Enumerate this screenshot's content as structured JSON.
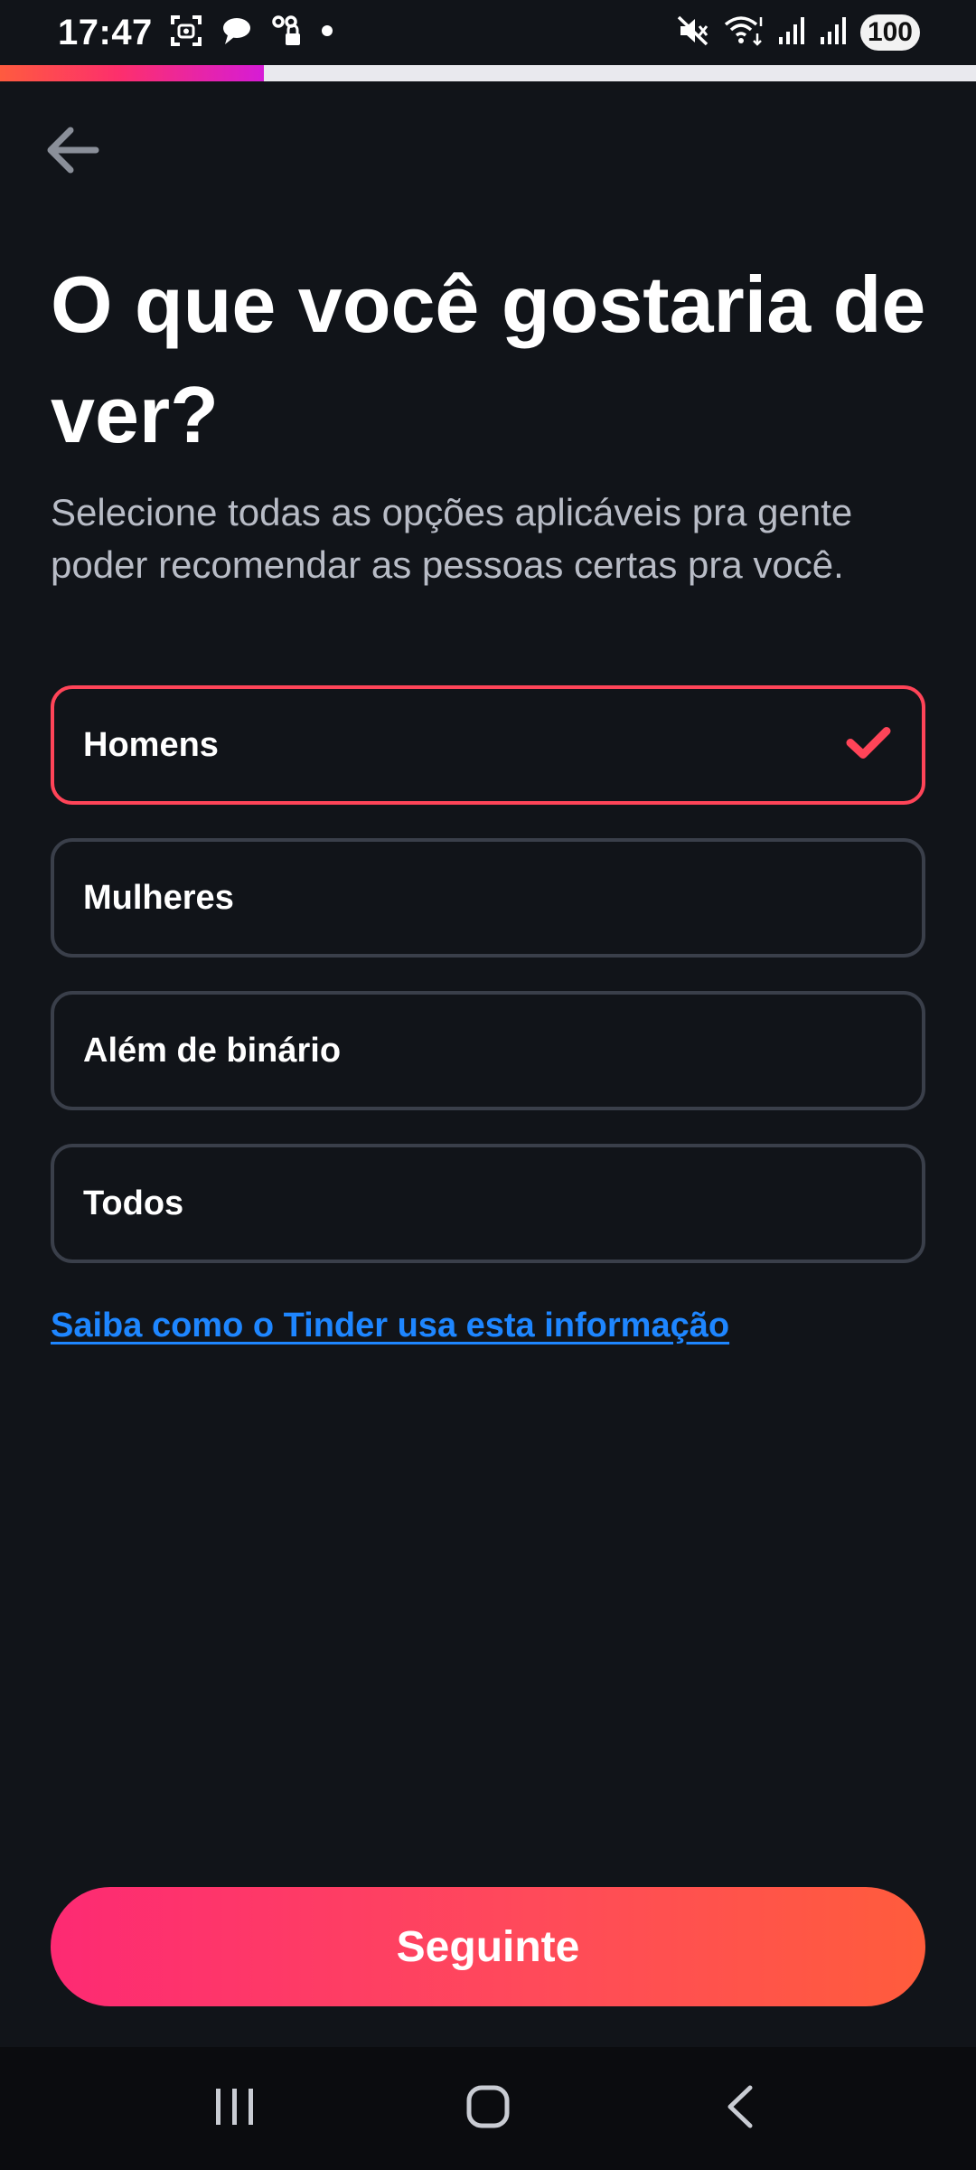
{
  "status_bar": {
    "time": "17:47",
    "battery": "100",
    "icons": [
      "screenshot-icon",
      "chat-bubble-icon",
      "link-lock-icon",
      "dot-icon",
      "mute-icon",
      "wifi-icon",
      "signal-icon",
      "signal-icon"
    ]
  },
  "progress": {
    "fraction": 0.27,
    "color_start": "#fe5b3f",
    "color_end": "#d61cd6"
  },
  "header": {
    "back_icon": "arrow-left-icon"
  },
  "page": {
    "title": "O que você gostaria de ver?",
    "subtitle": "Selecione todas as opções aplicáveis pra gente poder recomendar as pessoas certas pra você."
  },
  "options": [
    {
      "label": "Homens",
      "selected": true
    },
    {
      "label": "Mulheres",
      "selected": false
    },
    {
      "label": "Além de binário",
      "selected": false
    },
    {
      "label": "Todos",
      "selected": false
    }
  ],
  "info_link": {
    "label": "Saiba como o Tinder usa esta informação",
    "color": "#1e86ff"
  },
  "next_button": {
    "label": "Seguinte",
    "accent": "#ff4458"
  },
  "nav_bar": {
    "icons": [
      "recents-icon",
      "home-icon",
      "back-icon"
    ]
  }
}
